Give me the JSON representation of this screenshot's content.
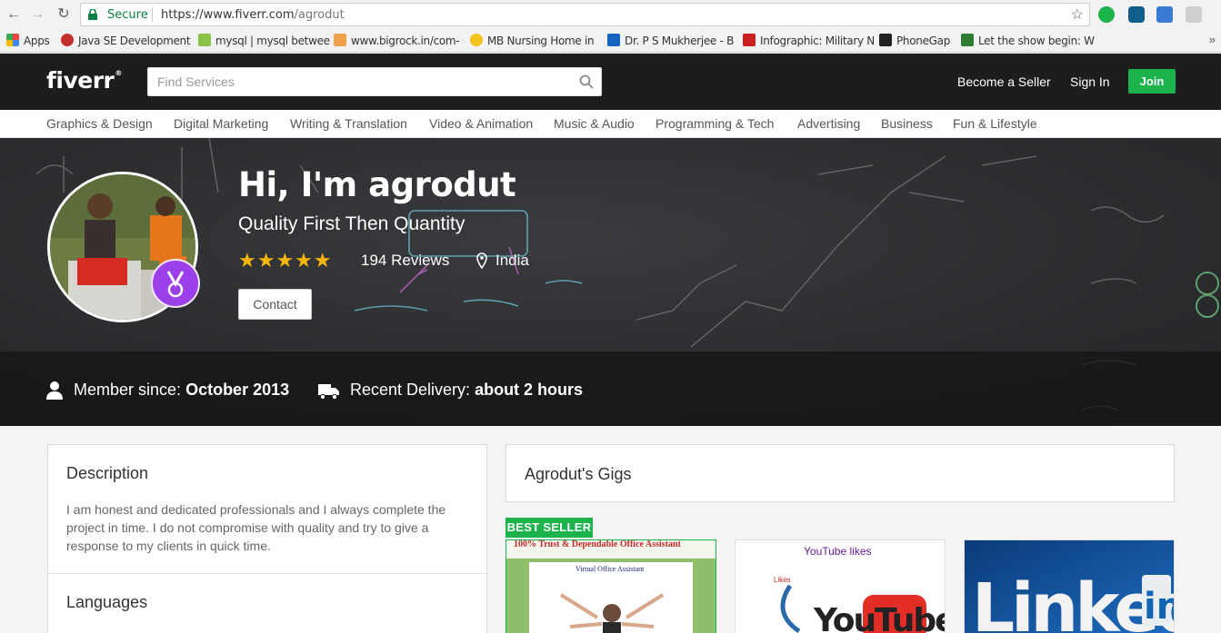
{
  "browser": {
    "secure_label": "Secure",
    "url_host": "https://www.fiverr.com",
    "url_path": "/agrodut",
    "bookmarks": [
      {
        "label": "Apps",
        "color": "#e44"
      },
      {
        "label": "Java SE Development",
        "color": "#c4302b"
      },
      {
        "label": "mysql | mysql betwee",
        "color": "#8bc34a"
      },
      {
        "label": "www.bigrock.in/com-",
        "color": "#f0a04b"
      },
      {
        "label": "MB Nursing Home in",
        "color": "#f2c218"
      },
      {
        "label": "Dr. P S Mukherjee - B",
        "color": "#1565c0"
      },
      {
        "label": "Infographic: Military N",
        "color": "#cc1f1f"
      },
      {
        "label": "PhoneGap",
        "color": "#222222"
      },
      {
        "label": "Let the show begin: W",
        "color": "#2e7d32"
      }
    ],
    "more_label": "»"
  },
  "header": {
    "logo": "fiverr",
    "logo_mark": "®",
    "search_placeholder": "Find Services",
    "become_seller": "Become a Seller",
    "sign_in": "Sign In",
    "join": "Join"
  },
  "categories": [
    "Graphics & Design",
    "Digital Marketing",
    "Writing & Translation",
    "Video & Animation",
    "Music & Audio",
    "Programming & Tech",
    "Advertising",
    "Business",
    "Fun & Lifestyle"
  ],
  "profile": {
    "name": "Hi, I'm agrodut",
    "tagline": "Quality First Then Quantity",
    "stars": "★★★★★",
    "rating": 5,
    "reviews": "194 Reviews",
    "country": "India",
    "contact": "Contact",
    "member_since_label": "Member since:",
    "member_since_value": "October 2013",
    "recent_delivery_label": "Recent Delivery:",
    "recent_delivery_value": "about 2 hours"
  },
  "description": {
    "title": "Description",
    "text": "I am honest and dedicated professionals and I always complete the project in time. I do not compromise with quality and try to give a response to my clients in quick time."
  },
  "languages": {
    "title": "Languages"
  },
  "gigs": {
    "title": "Agrodut's Gigs",
    "best_seller": "BEST SELLER",
    "items": [
      {
        "thumb_title": "100% Trust & Dependable Office Assistant",
        "thumb_sub": "Virtual Office Assistant"
      },
      {
        "thumb_title": "YouTube likes",
        "thumb_sub": "YouTube",
        "thumb_tag": "Likes"
      },
      {
        "thumb_title": "Linked",
        "thumb_sub": "in"
      }
    ]
  },
  "colors": {
    "brand_green": "#1cb24c",
    "header_bg": "#1d1d1d",
    "star": "#f6b60b",
    "badge": "#9b3fe8"
  }
}
